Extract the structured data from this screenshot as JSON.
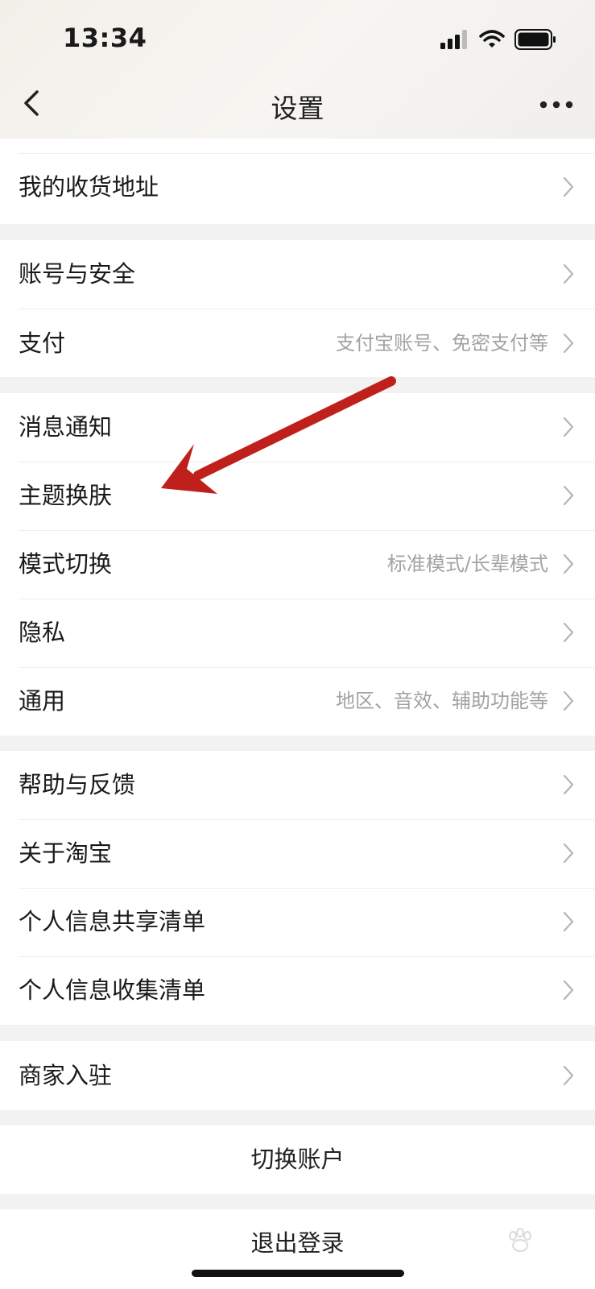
{
  "status_bar": {
    "time": "13:34"
  },
  "nav": {
    "title": "设置"
  },
  "sections": {
    "address": [
      {
        "label": "我的收货地址",
        "sub": ""
      }
    ],
    "account": [
      {
        "label": "账号与安全",
        "sub": ""
      },
      {
        "label": "支付",
        "sub": "支付宝账号、免密支付等"
      }
    ],
    "prefs": [
      {
        "label": "消息通知",
        "sub": ""
      },
      {
        "label": "主题换肤",
        "sub": ""
      },
      {
        "label": "模式切换",
        "sub": "标准模式/长辈模式"
      },
      {
        "label": "隐私",
        "sub": ""
      },
      {
        "label": "通用",
        "sub": "地区、音效、辅助功能等"
      }
    ],
    "about": [
      {
        "label": "帮助与反馈",
        "sub": ""
      },
      {
        "label": "关于淘宝",
        "sub": ""
      },
      {
        "label": "个人信息共享清单",
        "sub": ""
      },
      {
        "label": "个人信息收集清单",
        "sub": ""
      }
    ],
    "merchant": [
      {
        "label": "商家入驻",
        "sub": ""
      }
    ]
  },
  "actions": {
    "switch_account": "切换账户",
    "logout": "退出登录"
  },
  "colors": {
    "annotation_arrow": "#c0201b",
    "subtext": "#a3a3a3",
    "background": "#f2f2f2"
  }
}
